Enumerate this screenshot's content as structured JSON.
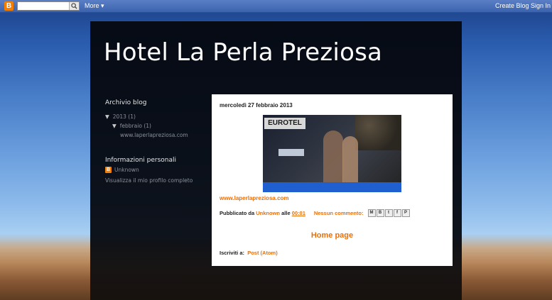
{
  "navbar": {
    "logo_letter": "B",
    "search_placeholder": "",
    "more_label": "More",
    "create_blog": "Create Blog",
    "sign_in": "Sign In"
  },
  "blog": {
    "title": "Hotel La Perla Preziosa"
  },
  "sidebar": {
    "archive_title": "Archivio blog",
    "archive_year": "2013",
    "archive_year_count": "(1)",
    "archive_month": "febbraio",
    "archive_month_count": "(1)",
    "archive_post": "www.laperlapreziosa.com",
    "profile_title": "Informazioni personali",
    "profile_icon_letter": "B",
    "profile_name": "Unknown",
    "profile_link": "Visualizza il mio profilo completo"
  },
  "post": {
    "date": "mercoledì 27 febbraio 2013",
    "image_sign_text": "EUROTEL",
    "link": "www.laperlapreziosa.com",
    "published_by": "Pubblicato da",
    "author": "Unknown",
    "at": "alle",
    "time": "00:01",
    "comments": "Nessun commento:",
    "share_buttons": [
      "M",
      "B",
      "t",
      "f",
      "P"
    ]
  },
  "home_page": "Home page",
  "subscribe": {
    "label": "Iscriviti a:",
    "feed": "Post (Atom)"
  },
  "colors": {
    "accent": "#e8700a",
    "blogger_orange": "#f57d00",
    "navbar": "#3b63ad"
  }
}
